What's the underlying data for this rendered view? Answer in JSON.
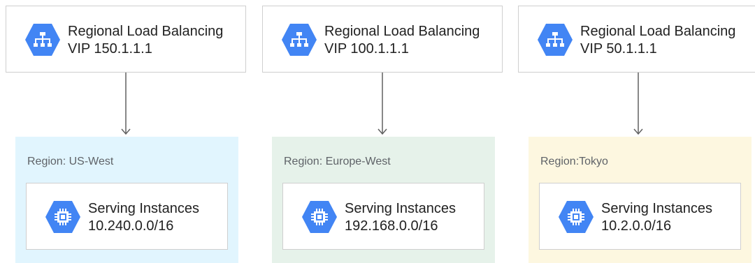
{
  "colors": {
    "hex_icon": "#4285f4",
    "us_west_bg": "#e1f5fe",
    "europe_west_bg": "#e6f2ea",
    "tokyo_bg": "#fdf7e0",
    "arrow": "#616161"
  },
  "columns": [
    {
      "load_balancer": {
        "icon": "load-balancer-icon",
        "title": "Regional Load Balancing",
        "vip": "VIP 150.1.1.1"
      },
      "region": {
        "label": "Region: US-West",
        "instances": {
          "icon": "compute-chip-icon",
          "title": "Serving Instances",
          "cidr": "10.240.0.0/16"
        }
      }
    },
    {
      "load_balancer": {
        "icon": "load-balancer-icon",
        "title": "Regional Load Balancing",
        "vip": "VIP 100.1.1.1"
      },
      "region": {
        "label": "Region: Europe-West",
        "instances": {
          "icon": "compute-chip-icon",
          "title": "Serving Instances",
          "cidr": "192.168.0.0/16"
        }
      }
    },
    {
      "load_balancer": {
        "icon": "load-balancer-icon",
        "title": "Regional Load Balancing",
        "vip": "VIP 50.1.1.1"
      },
      "region": {
        "label": "Region:Tokyo",
        "instances": {
          "icon": "compute-chip-icon",
          "title": "Serving Instances",
          "cidr": "10.2.0.0/16"
        }
      }
    }
  ]
}
